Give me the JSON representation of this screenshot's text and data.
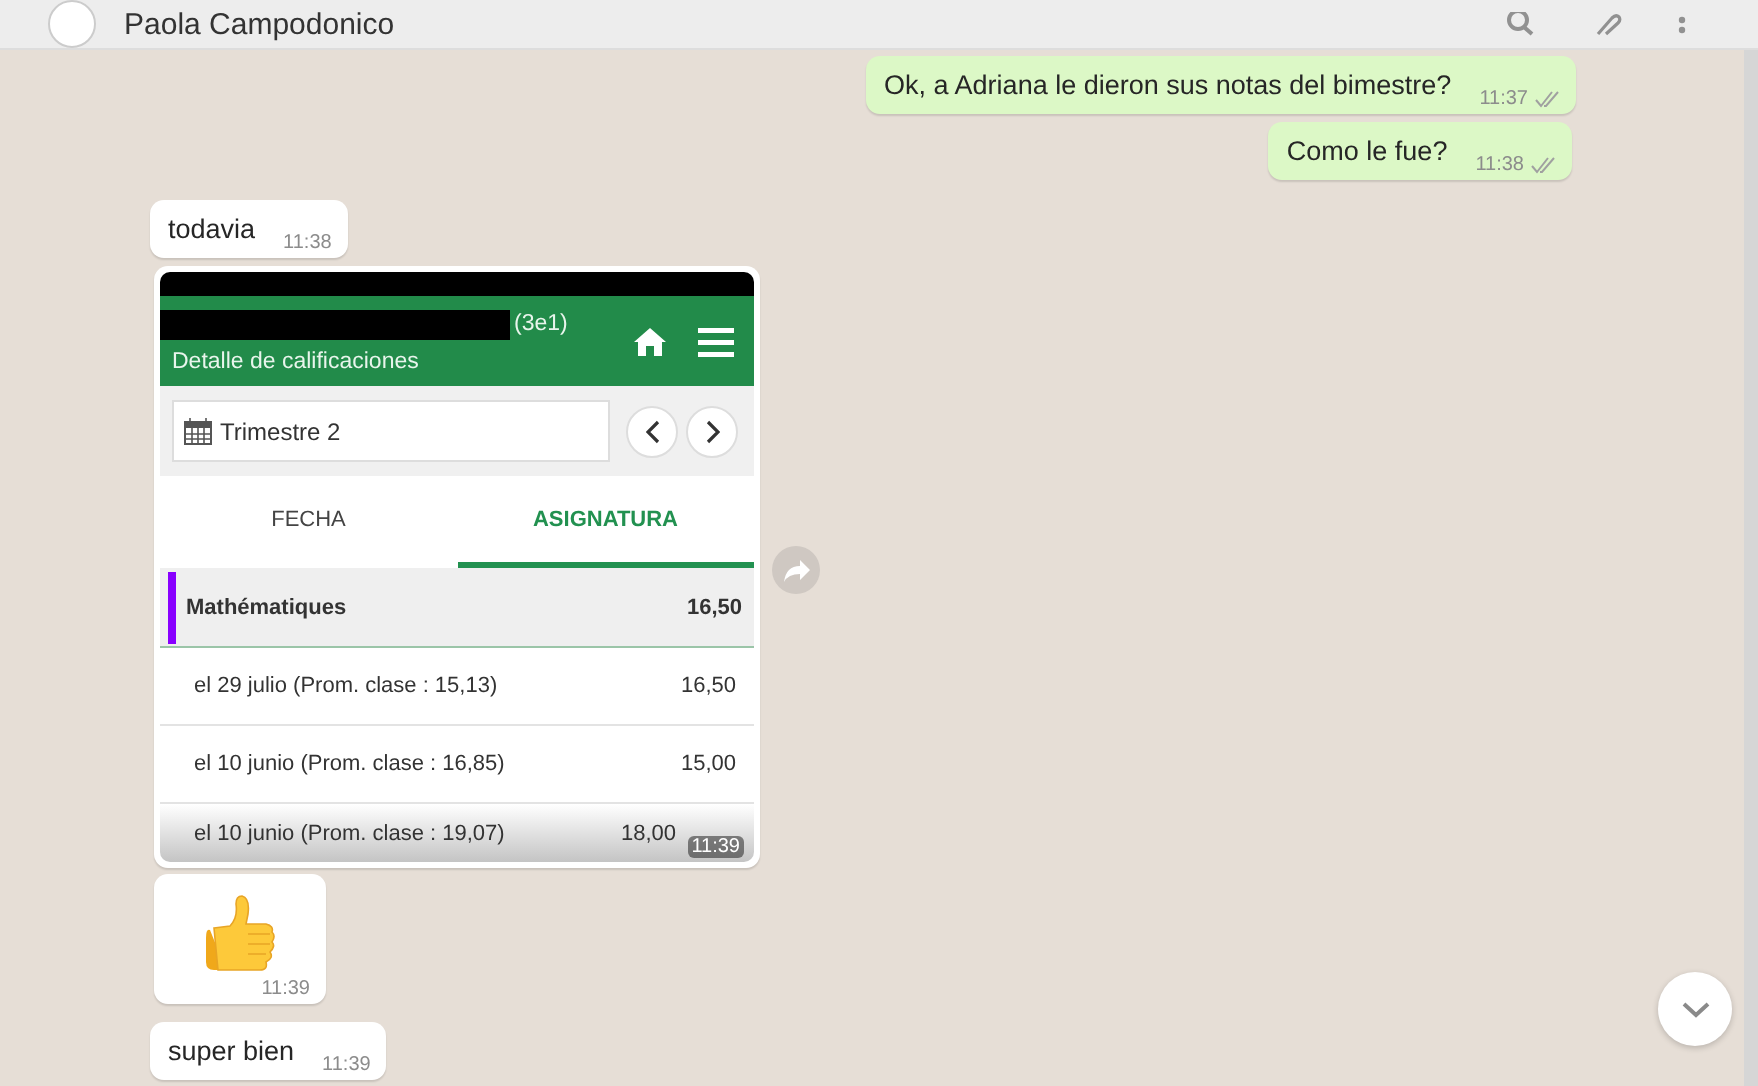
{
  "header": {
    "contact_name": "Paola Campodonico"
  },
  "messages": [
    {
      "kind": "text",
      "outgoing": true,
      "text": "Ok, a Adriana le dieron sus notas del bimestre?",
      "time": "11:37",
      "read": false
    },
    {
      "kind": "text",
      "outgoing": true,
      "text": "Como le fue?",
      "time": "11:38",
      "read": false
    },
    {
      "kind": "text",
      "outgoing": false,
      "text": "todavia",
      "time": "11:38"
    },
    {
      "kind": "image",
      "outgoing": false,
      "time": "11:39",
      "screenshot": {
        "badge": "(3e1)",
        "subtitle": "Detalle de calificaciones",
        "period_field": "Trimestre 2",
        "tabs": [
          {
            "label": "FECHA",
            "selected": false
          },
          {
            "label": "ASIGNATURA",
            "selected": true
          }
        ],
        "subject": {
          "name": "Mathématiques",
          "grade": "16,50",
          "color": "#8800ff"
        },
        "rows": [
          {
            "label": "el 29 julio (Prom. clase : 15,13)",
            "grade": "16,50"
          },
          {
            "label": "el 10 junio (Prom. clase : 16,85)",
            "grade": "15,00"
          },
          {
            "label": "el 10 junio (Prom. clase : 19,07)",
            "grade": "18,00"
          }
        ]
      }
    },
    {
      "kind": "emoji",
      "outgoing": false,
      "time": "11:39"
    },
    {
      "kind": "text",
      "outgoing": false,
      "text": "super bien",
      "time": "11:39"
    }
  ]
}
